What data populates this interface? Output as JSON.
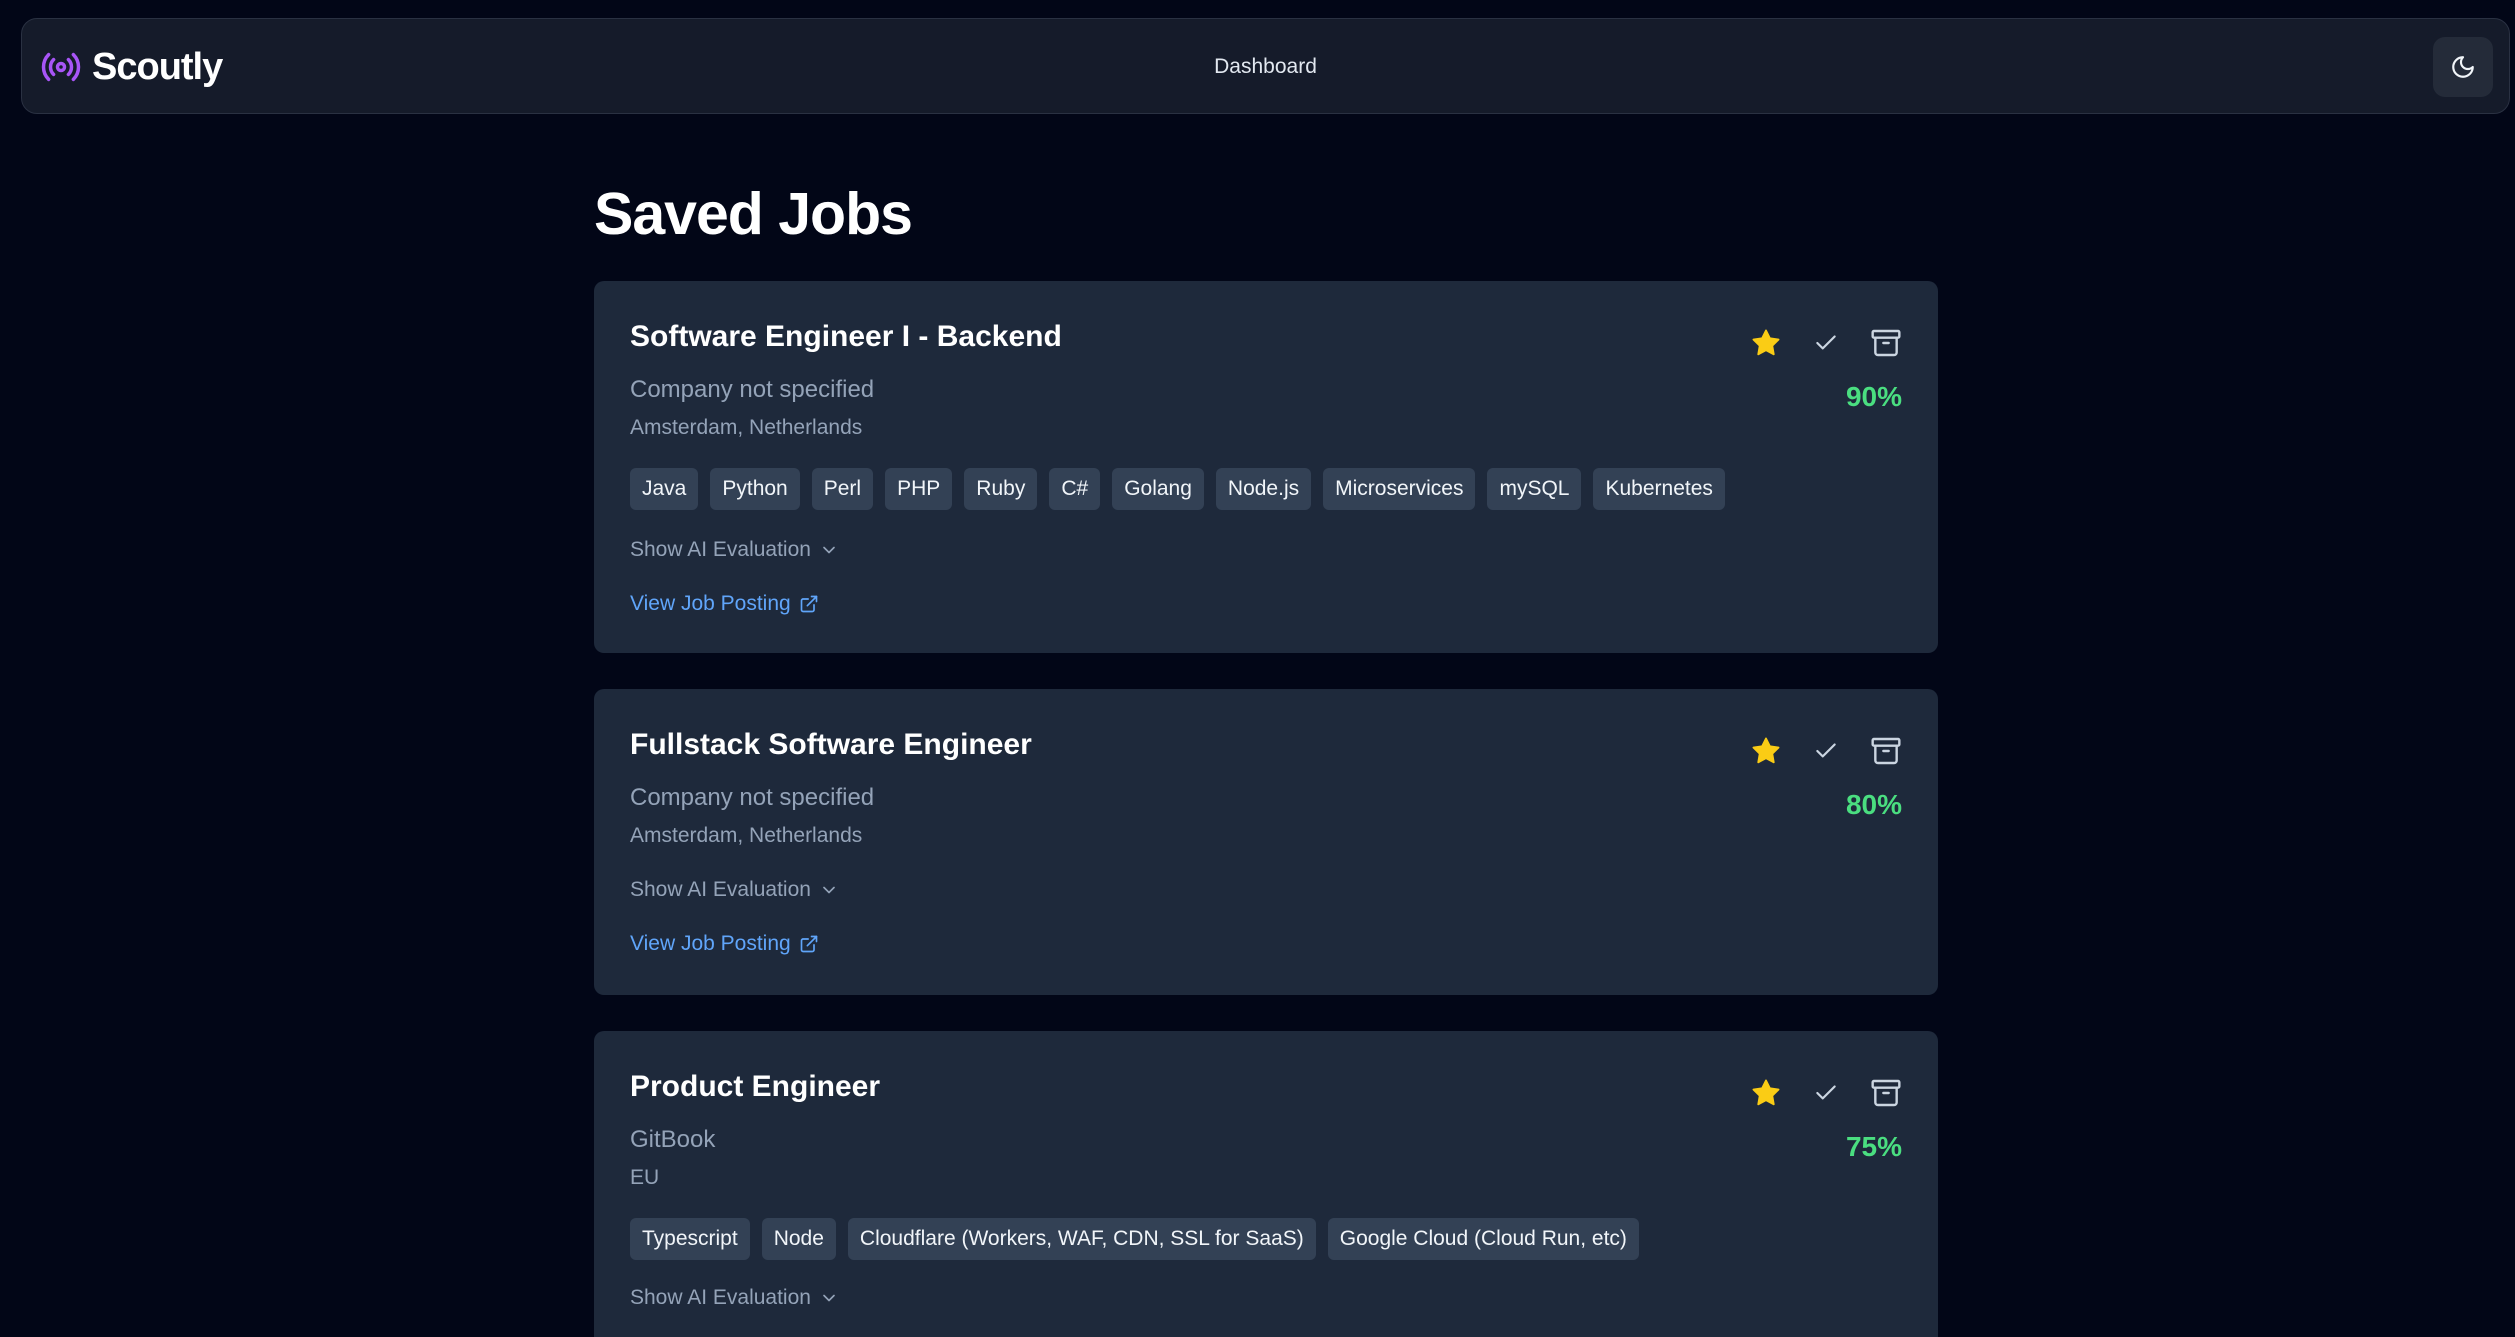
{
  "brand": {
    "name": "Scoutly",
    "icon": "broadcast-icon"
  },
  "nav": {
    "dashboard_label": "Dashboard",
    "theme_icon": "moon-icon"
  },
  "page": {
    "title": "Saved Jobs"
  },
  "labels": {
    "show_eval": "Show AI Evaluation",
    "view_posting": "View Job Posting"
  },
  "colors": {
    "accent": "#a855f7",
    "star": "#facc15",
    "score": "#4ade80",
    "link": "#60a5fa"
  },
  "jobs": [
    {
      "title": "Software Engineer I - Backend",
      "company": "Company not specified",
      "location": "Amsterdam, Netherlands",
      "score": "90%",
      "tags": [
        "Java",
        "Python",
        "Perl",
        "PHP",
        "Ruby",
        "C#",
        "Golang",
        "Node.js",
        "Microservices",
        "mySQL",
        "Kubernetes"
      ]
    },
    {
      "title": "Fullstack Software Engineer",
      "company": "Company not specified",
      "location": "Amsterdam, Netherlands",
      "score": "80%",
      "tags": []
    },
    {
      "title": "Product Engineer",
      "company": "GitBook",
      "location": "EU",
      "score": "75%",
      "tags": [
        "Typescript",
        "Node",
        "Cloudflare (Workers, WAF, CDN, SSL for SaaS)",
        "Google Cloud (Cloud Run, etc)"
      ]
    }
  ]
}
